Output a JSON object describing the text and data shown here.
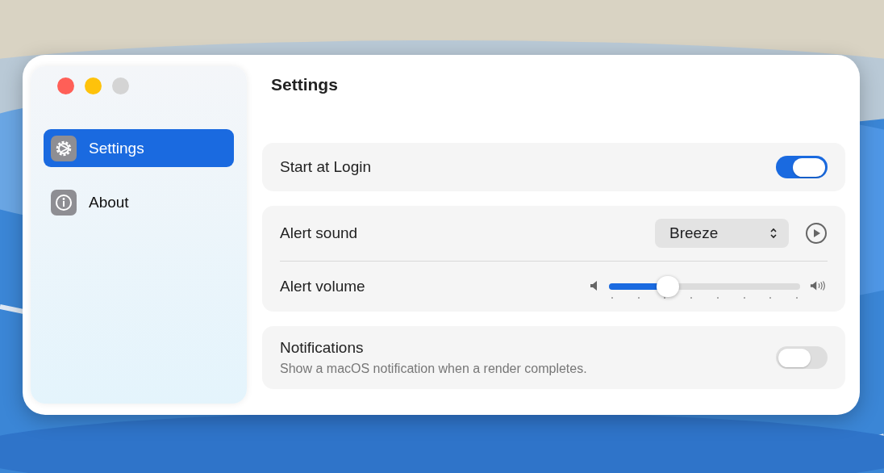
{
  "window": {
    "controls": [
      {
        "color": "#ff5f57"
      },
      {
        "color": "#fec20b"
      },
      {
        "color": "#d4d4d4"
      }
    ],
    "sidebar": {
      "items": [
        {
          "label": "Settings",
          "kind": "gear",
          "selected": true
        },
        {
          "label": "About",
          "kind": "info",
          "selected": false
        }
      ]
    },
    "title": "Settings"
  },
  "start_at_login": {
    "label": "Start at Login",
    "on": true
  },
  "alert_sound": {
    "label": "Alert sound",
    "value": "Breeze"
  },
  "alert_volume": {
    "label": "Alert volume",
    "level": 0.31
  },
  "notifications": {
    "label": "Notifications",
    "description": "Show a macOS notification when a render completes.",
    "on": false
  }
}
